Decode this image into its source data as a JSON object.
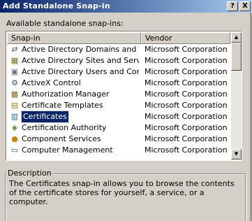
{
  "window": {
    "title": "Add Standalone Snap-in",
    "help_btn": "?",
    "close_btn": "X"
  },
  "available_label": "Available standalone snap-ins:",
  "columns": {
    "snapin": "Snap-in",
    "vendor": "Vendor"
  },
  "rows": [
    {
      "name": "Active Directory Domains and Trusts",
      "vendor": "Microsoft Corporation",
      "icon": "domains-trusts-icon",
      "glyph": "⇄",
      "color": "#5a5a5a"
    },
    {
      "name": "Active Directory Sites and Services",
      "vendor": "Microsoft Corporation",
      "icon": "sites-services-icon",
      "glyph": "▦",
      "color": "#7a6a20"
    },
    {
      "name": "Active Directory Users and Compu...",
      "vendor": "Microsoft Corporation",
      "icon": "users-computers-icon",
      "glyph": "▣",
      "color": "#6a6a8a"
    },
    {
      "name": "ActiveX Control",
      "vendor": "Microsoft Corporation",
      "icon": "activex-icon",
      "glyph": "⚙",
      "color": "#3a5a8a"
    },
    {
      "name": "Authorization Manager",
      "vendor": "Microsoft Corporation",
      "icon": "authorization-icon",
      "glyph": "▩",
      "color": "#8a6a2a"
    },
    {
      "name": "Certificate Templates",
      "vendor": "Microsoft Corporation",
      "icon": "cert-templates-icon",
      "glyph": "▤",
      "color": "#a08020"
    },
    {
      "name": "Certificates",
      "vendor": "Microsoft Corporation",
      "icon": "certificates-icon",
      "glyph": "▥",
      "color": "#2a6aa0",
      "selected": true
    },
    {
      "name": "Certification Authority",
      "vendor": "Microsoft Corporation",
      "icon": "cert-authority-icon",
      "glyph": "◈",
      "color": "#5a7a2a"
    },
    {
      "name": "Component Services",
      "vendor": "Microsoft Corporation",
      "icon": "component-services-icon",
      "glyph": "●",
      "color": "#c08a10"
    },
    {
      "name": "Computer Management",
      "vendor": "Microsoft Corporation",
      "icon": "computer-management-icon",
      "glyph": "▭",
      "color": "#2a4a7a"
    }
  ],
  "description": {
    "legend": "Description",
    "text": "The Certificates snap-in allows you to browse the contents of the certificate stores for yourself, a service, or a computer."
  }
}
